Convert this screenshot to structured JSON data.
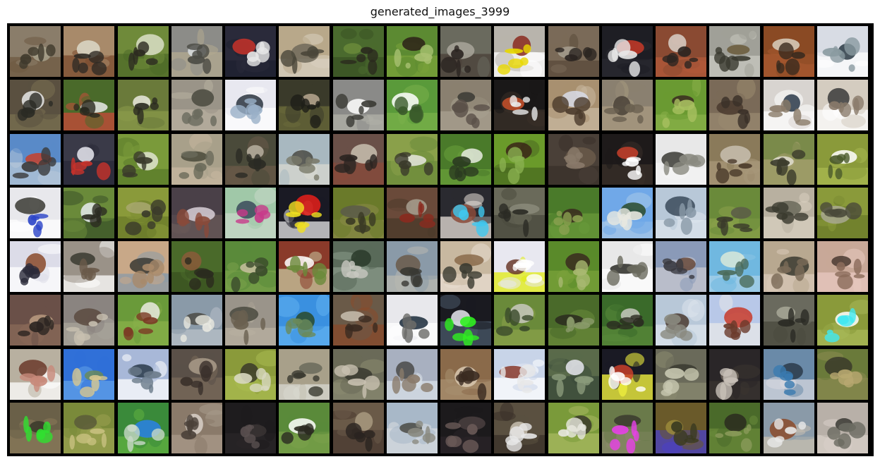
{
  "figure": {
    "title": "generated_images_3999",
    "grid": {
      "rows": 8,
      "cols": 16
    }
  },
  "tiles": [
    [
      "#8a7d6a",
      "#6d5a42",
      "#a8a28c",
      "#3f3a2c"
    ],
    [
      "#a88a6a",
      "#7a4a2e",
      "#dcd8c8",
      "#2f2a24"
    ],
    [
      "#6f8a3a",
      "#4d6a28",
      "#dcdfc8",
      "#2c2a20"
    ],
    [
      "#8c8c88",
      "#b3a990",
      "#d8dde0",
      "#4a4a44"
    ],
    [
      "#2a2a3a",
      "#1e2030",
      "#c8322a",
      "#e8e8e8"
    ],
    [
      "#b8a88a",
      "#d8d0c0",
      "#706a5a",
      "#4a463a"
    ],
    [
      "#4a6a2e",
      "#3a5224",
      "#6a8a3a",
      "#2a2a1e"
    ],
    [
      "#5c8a32",
      "#7aa23a",
      "#2c2018",
      "#a8c070"
    ],
    [
      "#6a6a5e",
      "#4a4038",
      "#a8a49a",
      "#2a2420"
    ],
    [
      "#b8b4ac",
      "#ffffff",
      "#8a2a1e",
      "#e8d800"
    ],
    [
      "#7a6a58",
      "#5a4a3a",
      "#a8a090",
      "#2a2420"
    ],
    [
      "#1e1e24",
      "#2a2a30",
      "#c83a28",
      "#e8e8e8"
    ],
    [
      "#8a4a32",
      "#b25a3a",
      "#d8d0c8",
      "#2a2420"
    ],
    [
      "#a0a098",
      "#c8c8c0",
      "#6a5a3a",
      "#3a3a30"
    ],
    [
      "#8a4a24",
      "#a85a30",
      "#d8d0c0",
      "#3a2a1e"
    ],
    [
      "#d8dce4",
      "#ffffff",
      "#2a3a44",
      "#8a9aa0"
    ],
    [
      "#5a5040",
      "#7a7050",
      "#e8e8e8",
      "#2a2a24"
    ],
    [
      "#4a6a2a",
      "#c84a3a",
      "#eaeaea",
      "#2a2a20"
    ],
    [
      "#6a7a3a",
      "#8a9a4a",
      "#eaeae0",
      "#2a2a20"
    ],
    [
      "#9a9488",
      "#b8b0a0",
      "#4a4a40",
      "#6a6a5e"
    ],
    [
      "#e8e8f0",
      "#ffffff",
      "#2a3440",
      "#9ab0c8"
    ],
    [
      "#3a3a2a",
      "#6a6a3a",
      "#b8a890",
      "#1e1e18"
    ],
    [
      "#8a8a88",
      "#b0b0a8",
      "#ffffff",
      "#3a3a34"
    ],
    [
      "#5a9a3a",
      "#7ab04a",
      "#ffffff",
      "#3a5a2a"
    ],
    [
      "#8a8070",
      "#a8a090",
      "#3a3a34",
      "#5a5048"
    ],
    [
      "#1a1818",
      "#3a3028",
      "#c8502a",
      "#e8e8e8"
    ],
    [
      "#a89070",
      "#c8b8a0",
      "#d8dce8",
      "#4a3a2a"
    ],
    [
      "#8a8070",
      "#a89a80",
      "#4a4238",
      "#6a6050"
    ],
    [
      "#6a9a32",
      "#8ab04a",
      "#3a2a20",
      "#a8c060"
    ],
    [
      "#7a6a58",
      "#9a8a70",
      "#4a3a2e",
      "#3a3028"
    ],
    [
      "#d8d4d0",
      "#ffffff",
      "#2a3a4a",
      "#8a7a68"
    ],
    [
      "#d4ccc0",
      "#ffffff",
      "#3a3a3a",
      "#8a7a6a"
    ],
    [
      "#5a8ac8",
      "#b8c8d8",
      "#c8402a",
      "#3a3a3a"
    ],
    [
      "#3a3a48",
      "#2a2a38",
      "#e8e8f0",
      "#c8322a"
    ],
    [
      "#7a9a3a",
      "#5a7a2a",
      "#e0e4d0",
      "#3a3a2a"
    ],
    [
      "#a8a08a",
      "#c8b8a0",
      "#4a4a3a",
      "#6a6a5a"
    ],
    [
      "#4a4a3a",
      "#6a5a48",
      "#b8b0a0",
      "#2a2a24"
    ],
    [
      "#a8b8c0",
      "#d8d8d0",
      "#4a4a44",
      "#7a7a6a"
    ],
    [
      "#6a5048",
      "#8a4a3a",
      "#c8c0b0",
      "#2a2420"
    ],
    [
      "#8aa04a",
      "#6a8a3a",
      "#e8e8e0",
      "#3a3a2a"
    ],
    [
      "#4a7a2a",
      "#6aa03a",
      "#e8ece0",
      "#2a3a20"
    ],
    [
      "#6a9a2a",
      "#4a6a20",
      "#3a2418",
      "#8ab050"
    ],
    [
      "#4a4038",
      "#3a302a",
      "#6a5a4a",
      "#8a7a6a"
    ],
    [
      "#1e1a1a",
      "#3a302a",
      "#c8402a",
      "#ffffff"
    ],
    [
      "#e8e8e8",
      "#f4f4f4",
      "#3a3a34",
      "#8a8a80"
    ],
    [
      "#8a7a5a",
      "#a8987a",
      "#c8c0b0",
      "#4a3a2a"
    ],
    [
      "#7a8a4a",
      "#a8a070",
      "#e0ddd0",
      "#3a3a2a"
    ],
    [
      "#8a9a3a",
      "#a8b850",
      "#ffffff",
      "#4a5a2a"
    ],
    [
      "#e8e8ec",
      "#ffffff",
      "#3a3a34",
      "#2a44c8"
    ],
    [
      "#6a8a3a",
      "#3a5228",
      "#e8ecf0",
      "#2a2a20"
    ],
    [
      "#8a9a3a",
      "#6a7a2a",
      "#a8a870",
      "#3a3a2a"
    ],
    [
      "#4a4048",
      "#6a5a58",
      "#d8d0d8",
      "#8a4a3a"
    ],
    [
      "#a0c8a8",
      "#c8d8c8",
      "#3a4a5a",
      "#c83a8a"
    ],
    [
      "#1a1a24",
      "#e8e8e8",
      "#e8201a",
      "#f0e020"
    ],
    [
      "#6a7a2a",
      "#8a8a48",
      "#5a5a4a",
      "#3a3a24"
    ],
    [
      "#6a4a3a",
      "#4a3a2a",
      "#a8a090",
      "#8a2a1e"
    ],
    [
      "#2a2a30",
      "#e8e0d8",
      "#8a4a3a",
      "#40c8f0"
    ],
    [
      "#6a6a5a",
      "#4a4a3e",
      "#8a8a7a",
      "#2a2a24"
    ],
    [
      "#4a7a2a",
      "#6a9a3a",
      "#3a2a1e",
      "#8aa050"
    ],
    [
      "#70a8e8",
      "#a8c8e8",
      "#2a4a2a",
      "#e8e8e0"
    ],
    [
      "#b8c8d8",
      "#dce4ec",
      "#3a4a5a",
      "#8a9aa8"
    ],
    [
      "#6a8a3a",
      "#8aa04a",
      "#5a5a48",
      "#3a3a2a"
    ],
    [
      "#b8b0a0",
      "#d8d0c0",
      "#6a6a5a",
      "#3a3a2e"
    ],
    [
      "#8a9a3a",
      "#6a7a2a",
      "#a8a890",
      "#4a4a3a"
    ],
    [
      "#dcdce8",
      "#ffffff",
      "#8a4a2a",
      "#2a2a3a"
    ],
    [
      "#9a9288",
      "#ffffff",
      "#3a3a30",
      "#6a5a4a"
    ],
    [
      "#c8a888",
      "#8a9aa8",
      "#3a3a34",
      "#a88a6a"
    ],
    [
      "#4a6a2a",
      "#3a5220",
      "#8a5a3a",
      "#2a2a1e"
    ],
    [
      "#5a8a3a",
      "#7aa04a",
      "#c8c0a0",
      "#3a4a2a"
    ],
    [
      "#8a3a2a",
      "#c8c8a0",
      "#ffffff",
      "#6a8a3a"
    ],
    [
      "#5a6a5a",
      "#8a9a8a",
      "#2a3a2a",
      "#c8c8c0"
    ],
    [
      "#8a9aa8",
      "#b8b8b0",
      "#6a5a4a",
      "#3a3a34"
    ],
    [
      "#c8b8a0",
      "#e8dcd0",
      "#8a6a4a",
      "#3a3a30"
    ],
    [
      "#e8e8f0",
      "#e0ec10",
      "#6a3a2a",
      "#ffffff"
    ],
    [
      "#5a8a2a",
      "#7aa03a",
      "#3a2a1e",
      "#a8b870"
    ],
    [
      "#e8e8e8",
      "#ffffff",
      "#2a2a24",
      "#6a6a5e"
    ],
    [
      "#8a9ab8",
      "#c8c8d0",
      "#6a4a3a",
      "#3a3a40"
    ],
    [
      "#70b8e0",
      "#a8d0e8",
      "#d8e8d8",
      "#4a6a5a"
    ],
    [
      "#b8a890",
      "#d8c8b8",
      "#3a3a30",
      "#7a6a58"
    ],
    [
      "#c8a898",
      "#e8c8c0",
      "#4a3a30",
      "#8a6a5a"
    ],
    [
      "#6a5048",
      "#8a6a58",
      "#b89a80",
      "#2a2420"
    ],
    [
      "#8a8480",
      "#a8a49a",
      "#5a4a40",
      "#c8c0b0"
    ],
    [
      "#6a9a3a",
      "#8ab04a",
      "#eaeae0",
      "#7a3a24"
    ],
    [
      "#8a9aa8",
      "#b8c0c8",
      "#4a4a44",
      "#e8e8e0"
    ],
    [
      "#9a948a",
      "#b8b0a0",
      "#4a4a40",
      "#6a6050"
    ],
    [
      "#3a90e0",
      "#60b0f0",
      "#2a4a2a",
      "#6a8a5a"
    ],
    [
      "#6a5a48",
      "#8a4a2a",
      "#c8c0b0",
      "#3a2a20"
    ],
    [
      "#e8e8ec",
      "#ffffff",
      "#1a2a3a",
      "#6a6a68"
    ],
    [
      "#1a1a20",
      "#4a5a6a",
      "#e8e8f0",
      "#30f020"
    ],
    [
      "#6a8a3a",
      "#8aa04a",
      "#c8c8c0",
      "#3a4a2a"
    ],
    [
      "#4a6a2a",
      "#6a8a3a",
      "#2a2a1e",
      "#8a9a6a"
    ],
    [
      "#3a6a2a",
      "#5a8a3a",
      "#c8c8c0",
      "#2a2a20"
    ],
    [
      "#b8c8d8",
      "#dce4ec",
      "#4a3a30",
      "#8a8a80"
    ],
    [
      "#b8c8e8",
      "#e8e8e8",
      "#c83a2a",
      "#6a3a2a"
    ],
    [
      "#6a6a5e",
      "#4a4a3e",
      "#a8a898",
      "#2a2a24"
    ],
    [
      "#8a9a3a",
      "#a8b858",
      "#ffffff",
      "#40e8f0"
    ],
    [
      "#b8b0a0",
      "#ffffff",
      "#6a3a2a",
      "#c88a7a"
    ],
    [
      "#3070d8",
      "#60a0e8",
      "#6a8a5a",
      "#d8c890"
    ],
    [
      "#a8b8d8",
      "#ffffff",
      "#2a3a4a",
      "#6a7a8a"
    ],
    [
      "#5a5048",
      "#7a6a5a",
      "#a89a88",
      "#3a302a"
    ],
    [
      "#8a9a3a",
      "#aabb50",
      "#3a3a2a",
      "#d8d8c0"
    ],
    [
      "#a8a08a",
      "#d8d8d0",
      "#6a6a5a",
      "#3a3a30"
    ],
    [
      "#6a6a58",
      "#8a8a70",
      "#3a3a30",
      "#c8c0b0"
    ],
    [
      "#a8b0c0",
      "#d8e0e8",
      "#4a4a48",
      "#8a7a6a"
    ],
    [
      "#8a6a4a",
      "#a89070",
      "#d8c8b0",
      "#3a2a20"
    ],
    [
      "#c8d4e8",
      "#ffffff",
      "#8a3a2a",
      "#e8e8e8"
    ],
    [
      "#5a6a4a",
      "#3a4a3a",
      "#e8e8f0",
      "#8a9a7a"
    ],
    [
      "#1a1a24",
      "#ffff40",
      "#c8402a",
      "#ffffff"
    ],
    [
      "#6a6a5a",
      "#8a8a70",
      "#3a3a30",
      "#c8c8b0"
    ],
    [
      "#2a2628",
      "#3a3430",
      "#6a6058",
      "#c8c0b8"
    ],
    [
      "#6a8aa8",
      "#d8d8e0",
      "#2a3a4a",
      "#3a7ab0"
    ],
    [
      "#6a7a3a",
      "#8a8a50",
      "#3a3a2a",
      "#b8a870"
    ],
    [
      "#6a6048",
      "#8a7a5a",
      "#3a3a2a",
      "#30e030"
    ],
    [
      "#7a8a3a",
      "#9aa050",
      "#5a5a3a",
      "#c8c080"
    ],
    [
      "#3a8a3a",
      "#60b040",
      "#2a80e8",
      "#c8d8c8"
    ],
    [
      "#8a7a6a",
      "#a89a8a",
      "#d8d0c8",
      "#4a4038"
    ],
    [
      "#1e1c1e",
      "#2a2628",
      "#3a3434",
      "#5a5050"
    ],
    [
      "#5a8a3a",
      "#7aa04a",
      "#ffffff",
      "#2a2a20"
    ],
    [
      "#6a5a48",
      "#4a3a30",
      "#a89a80",
      "#2a2420"
    ],
    [
      "#a8b8c8",
      "#d8dce0",
      "#4a4a44",
      "#8a8a80"
    ],
    [
      "#1c1a1c",
      "#2a2428",
      "#4a4040",
      "#6a5a58"
    ],
    [
      "#5a5040",
      "#3a3028",
      "#c8c0b0",
      "#e8e8e8"
    ],
    [
      "#7a9a3a",
      "#a8b860",
      "#3a3a2a",
      "#e8e8e0"
    ],
    [
      "#6a7a4a",
      "#8a8a6a",
      "#3a3a2e",
      "#e840e8"
    ],
    [
      "#6a5a2a",
      "#4a40c8",
      "#9a8a3a",
      "#3a3a20"
    ],
    [
      "#4a6a2a",
      "#6a8a3a",
      "#2a2a1e",
      "#8a9a5a"
    ],
    [
      "#8a9aa8",
      "#c8c0b0",
      "#8a4a2a",
      "#e8e8e8"
    ],
    [
      "#b8b0a8",
      "#d8d0c8",
      "#3a3a34",
      "#6a6a60"
    ]
  ]
}
